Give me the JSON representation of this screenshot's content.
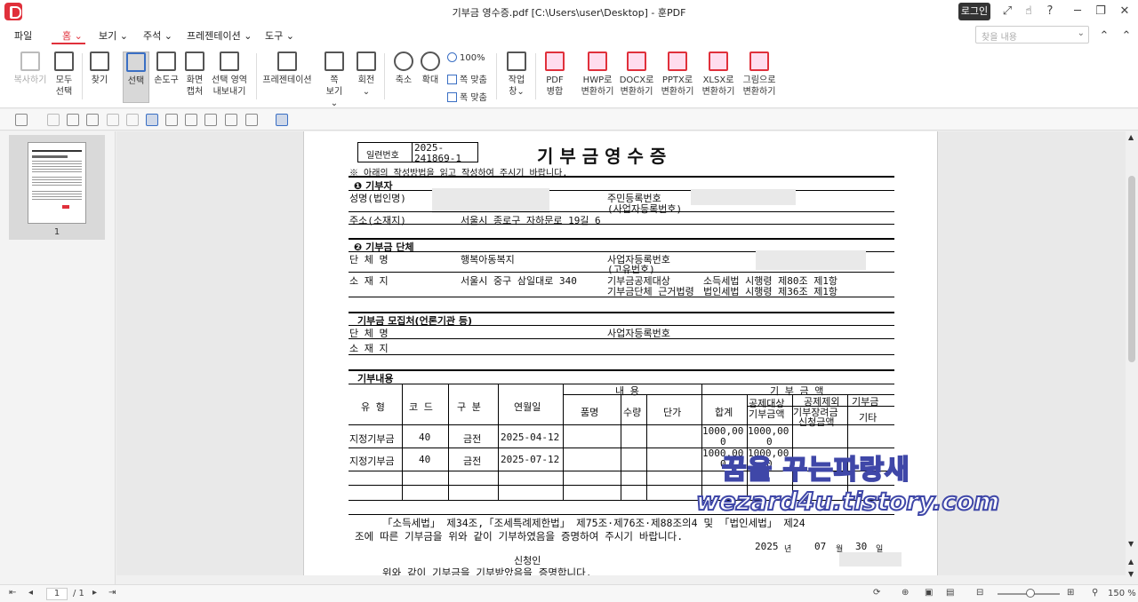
{
  "window": {
    "title": "기부금 영수증.pdf [C:\\Users\\user\\Desktop] - 훈PDF",
    "login_label": "로그인"
  },
  "menu": {
    "items": [
      "파일",
      "홈",
      "보기",
      "주석",
      "프레젠테이션",
      "도구"
    ],
    "active": "홈",
    "search_placeholder": "찾을 내용"
  },
  "ribbon": {
    "copy": "복사하기",
    "select_all_1": "모두",
    "select_all_2": "선택",
    "find": "찾기",
    "select": "선택",
    "hand": "손도구",
    "capture_1": "화면",
    "capture_2": "캡처",
    "export_1": "선택 영역",
    "export_2": "내보내기",
    "presentation": "프레젠테이션",
    "page_view_1": "쪽",
    "page_view_2": "보기",
    "rotate": "회전",
    "zoom_out": "축소",
    "zoom_in": "확대",
    "zoom_100": "100%",
    "fit_page": "쪽 맞춤",
    "fit_width": "폭 맞춤",
    "work_window_1": "작업",
    "work_window_2": "창",
    "merge_1": "PDF",
    "merge_2": "병합",
    "hwp_1": "HWP로",
    "hwp_2": "변환하기",
    "docx_1": "DOCX로",
    "docx_2": "변환하기",
    "pptx_1": "PPTX로",
    "pptx_2": "변환하기",
    "xlsx_1": "XLSX로",
    "xlsx_2": "변환하기",
    "image_1": "그림으로",
    "image_2": "변환하기"
  },
  "thumbnail": {
    "page_number": "1"
  },
  "doc": {
    "serial_label": "일련번호",
    "serial_value_1": "2025-",
    "serial_value_2": "241869-1",
    "title": "기 부 금  영 수 증",
    "note": "※ 아래의 작성방법을 읽고 작성하여 주시기 바랍니다.",
    "s1_head": "❶ 기부자",
    "s1_name": "성명(법인명)",
    "s1_rrn_1": "주민등록번호",
    "s1_rrn_2": "(사업자등록번호)",
    "s1_addr_label": "주소(소재지)",
    "s1_addr": "서울시 종로구 자하문로 19길 6",
    "s2_head": "❷ 기부금 단체",
    "s2_org_label": "단 체 명",
    "s2_org": "행복아동복지",
    "s2_biz_1": "사업자등록번호",
    "s2_biz_2": "(고유번호)",
    "s2_loc_label": "소 재 지",
    "s2_loc": "서울시 중구 삼일대로 340",
    "s2_basis_1": "기부금공제대상",
    "s2_basis_2": "기부금단체 근거법령",
    "s2_law_1": "소득세법 시행령 제80조 제1항",
    "s2_law_2": "법인세법 시행령 제36조 제1항",
    "s3_head": "기부금 모집처(언론기관 등)",
    "s3_org": "단 체 명",
    "s3_biz": "사업자등록번호",
    "s3_loc": "소 재 지",
    "s4_head": "기부내용",
    "col_type": "유  형",
    "col_code": "코  드",
    "col_div": "구  분",
    "col_date": "연월일",
    "col_content": "내   용",
    "col_item": "품명",
    "col_qty": "수량",
    "col_price": "단가",
    "col_amount": "기 부 금 액",
    "col_total": "합계",
    "col_deduct_1": "공제대상",
    "col_deduct_2": "기부금액",
    "col_excl_1": "공제제외",
    "col_excl_2": "기부장려금",
    "col_excl_3": "신청금액",
    "col_etc_1": "기부금",
    "col_etc_2": "기타",
    "rows": [
      {
        "type": "지정기부금",
        "code": "40",
        "div": "금전",
        "date": "2025-04-12",
        "total_1": "1000,00",
        "total_2": "0",
        "deduct_1": "1000,00",
        "deduct_2": "0"
      },
      {
        "type": "지정기부금",
        "code": "40",
        "div": "금전",
        "date": "2025-07-12",
        "total_1": "1000,00",
        "total_2": "0",
        "deduct_1": "1000,00",
        "deduct_2": "0"
      }
    ],
    "footer_1": "「소득세법」 제34조,「조세특례제한법」 제75조·제76조·제88조의4 및 「법인세법」 제24",
    "footer_2": "조에 따른 기부금을 위와 같이 기부하였음을 증명하여 주시기 바랍니다.",
    "date_year": "2025",
    "date_year_unit": "년",
    "date_month": "07",
    "date_month_unit": "월",
    "date_day": "30",
    "date_day_unit": "일",
    "applicant": "신청인",
    "footer_3": "위와 같이 기부금을 기부받았음을 증명합니다."
  },
  "watermark": {
    "line1": "꿈을 꾸는파랑새",
    "line2": "wezard4u.tistory.com"
  },
  "status": {
    "page_current": "1",
    "page_total": "/ 1",
    "zoom": "150 %"
  }
}
